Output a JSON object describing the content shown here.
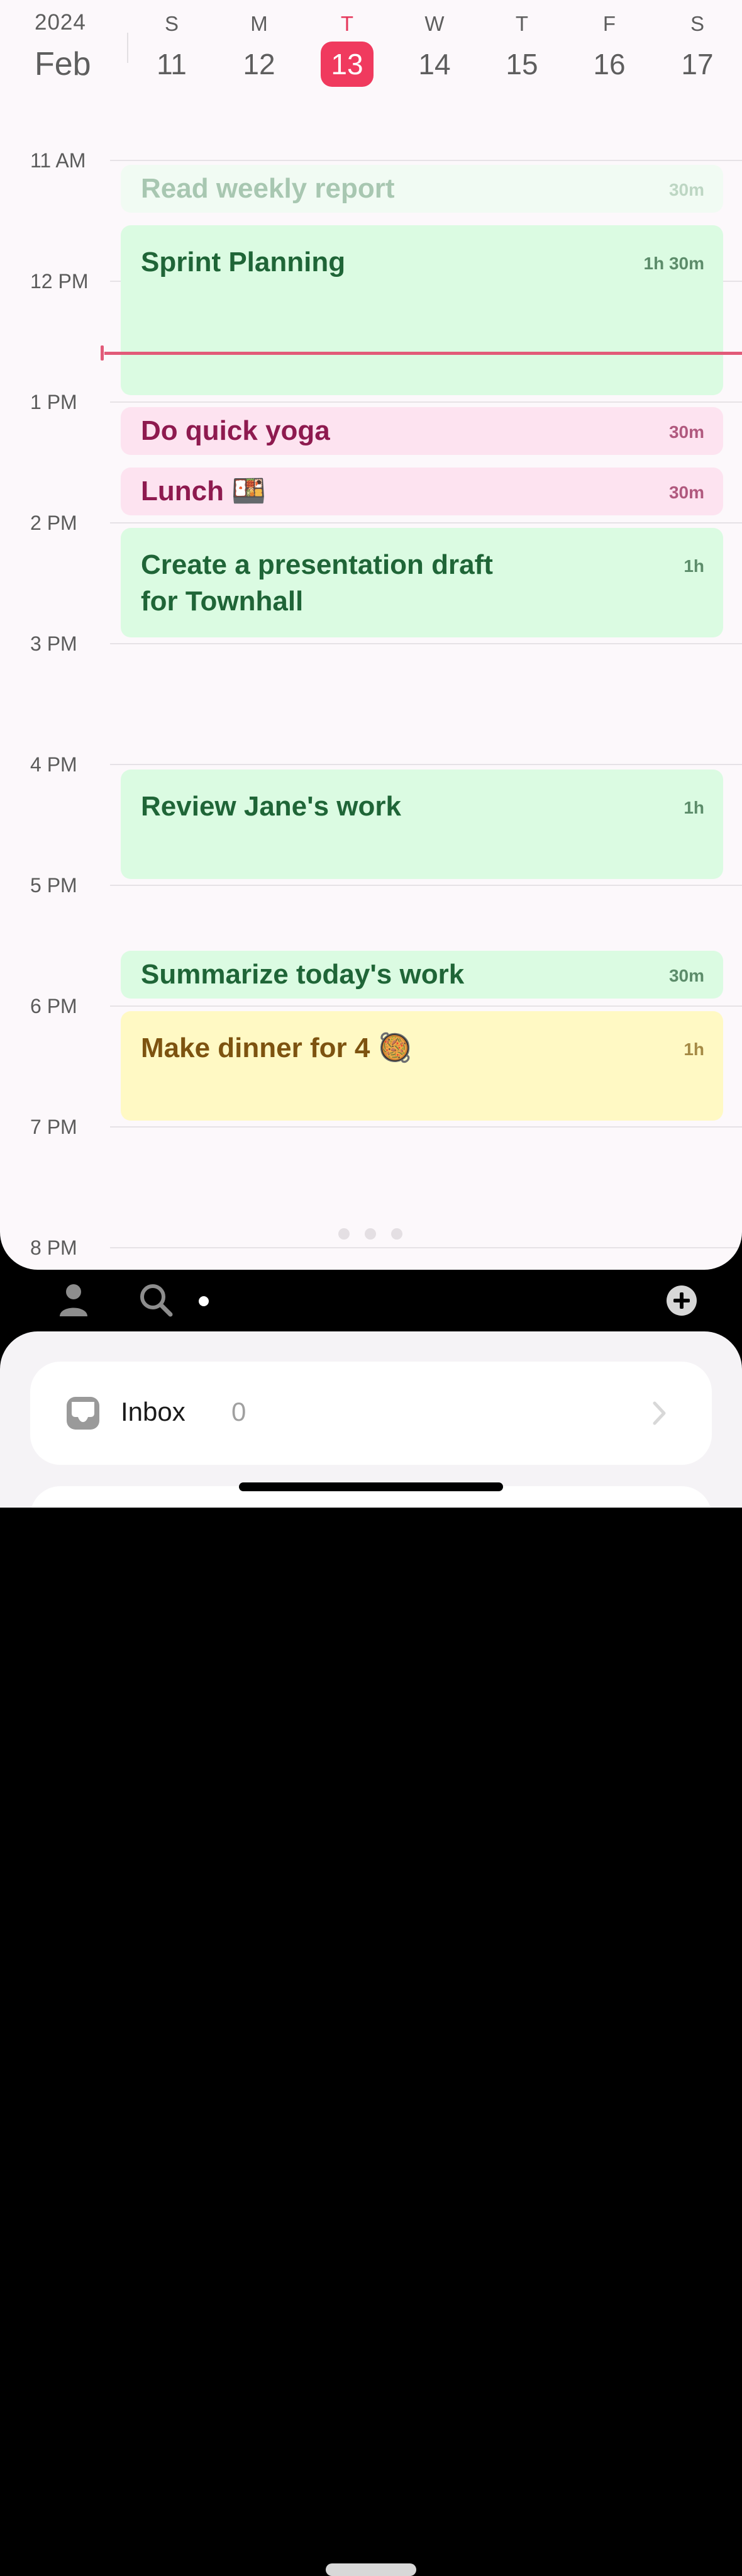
{
  "header": {
    "year": "2024",
    "month": "Feb",
    "days": [
      {
        "weekday": "S",
        "date": "11",
        "today": false
      },
      {
        "weekday": "M",
        "date": "12",
        "today": false
      },
      {
        "weekday": "T",
        "date": "13",
        "today": true
      },
      {
        "weekday": "W",
        "date": "14",
        "today": false
      },
      {
        "weekday": "T",
        "date": "15",
        "today": false
      },
      {
        "weekday": "F",
        "date": "16",
        "today": false
      },
      {
        "weekday": "S",
        "date": "17",
        "today": false
      }
    ]
  },
  "hours": [
    "11 AM",
    "12 PM",
    "1 PM",
    "2 PM",
    "3 PM",
    "4 PM",
    "5 PM",
    "6 PM",
    "7 PM",
    "8 PM"
  ],
  "events": [
    {
      "title": "Read weekly report",
      "duration": "30m",
      "color": "green",
      "state": "past"
    },
    {
      "title": "Sprint Planning",
      "duration": "1h 30m",
      "color": "green",
      "state": "current"
    },
    {
      "title": "Do quick yoga",
      "duration": "30m",
      "color": "pink",
      "state": "upcoming"
    },
    {
      "title": "Lunch 🍱",
      "duration": "30m",
      "color": "pink",
      "state": "upcoming"
    },
    {
      "title": "Create a presentation draft\nfor Townhall",
      "duration": "1h",
      "color": "green",
      "state": "upcoming"
    },
    {
      "title": "Review Jane's work",
      "duration": "1h",
      "color": "green",
      "state": "upcoming"
    },
    {
      "title": "Summarize today's work",
      "duration": "30m",
      "color": "green",
      "state": "upcoming"
    },
    {
      "title": "Make dinner for 4 🥘",
      "duration": "1h",
      "color": "yellow",
      "state": "upcoming"
    }
  ],
  "toolbar": {
    "icons": [
      "profile-icon",
      "search-icon",
      "dot-indicator",
      "add-icon"
    ]
  },
  "inbox": {
    "label": "Inbox",
    "count": "0"
  },
  "colors": {
    "today_accent": "#f03a5e",
    "now_line": "#e25a78",
    "green_bg": "#dbfbe2",
    "pink_bg": "#fde3f0",
    "yellow_bg": "#fff9c4"
  }
}
